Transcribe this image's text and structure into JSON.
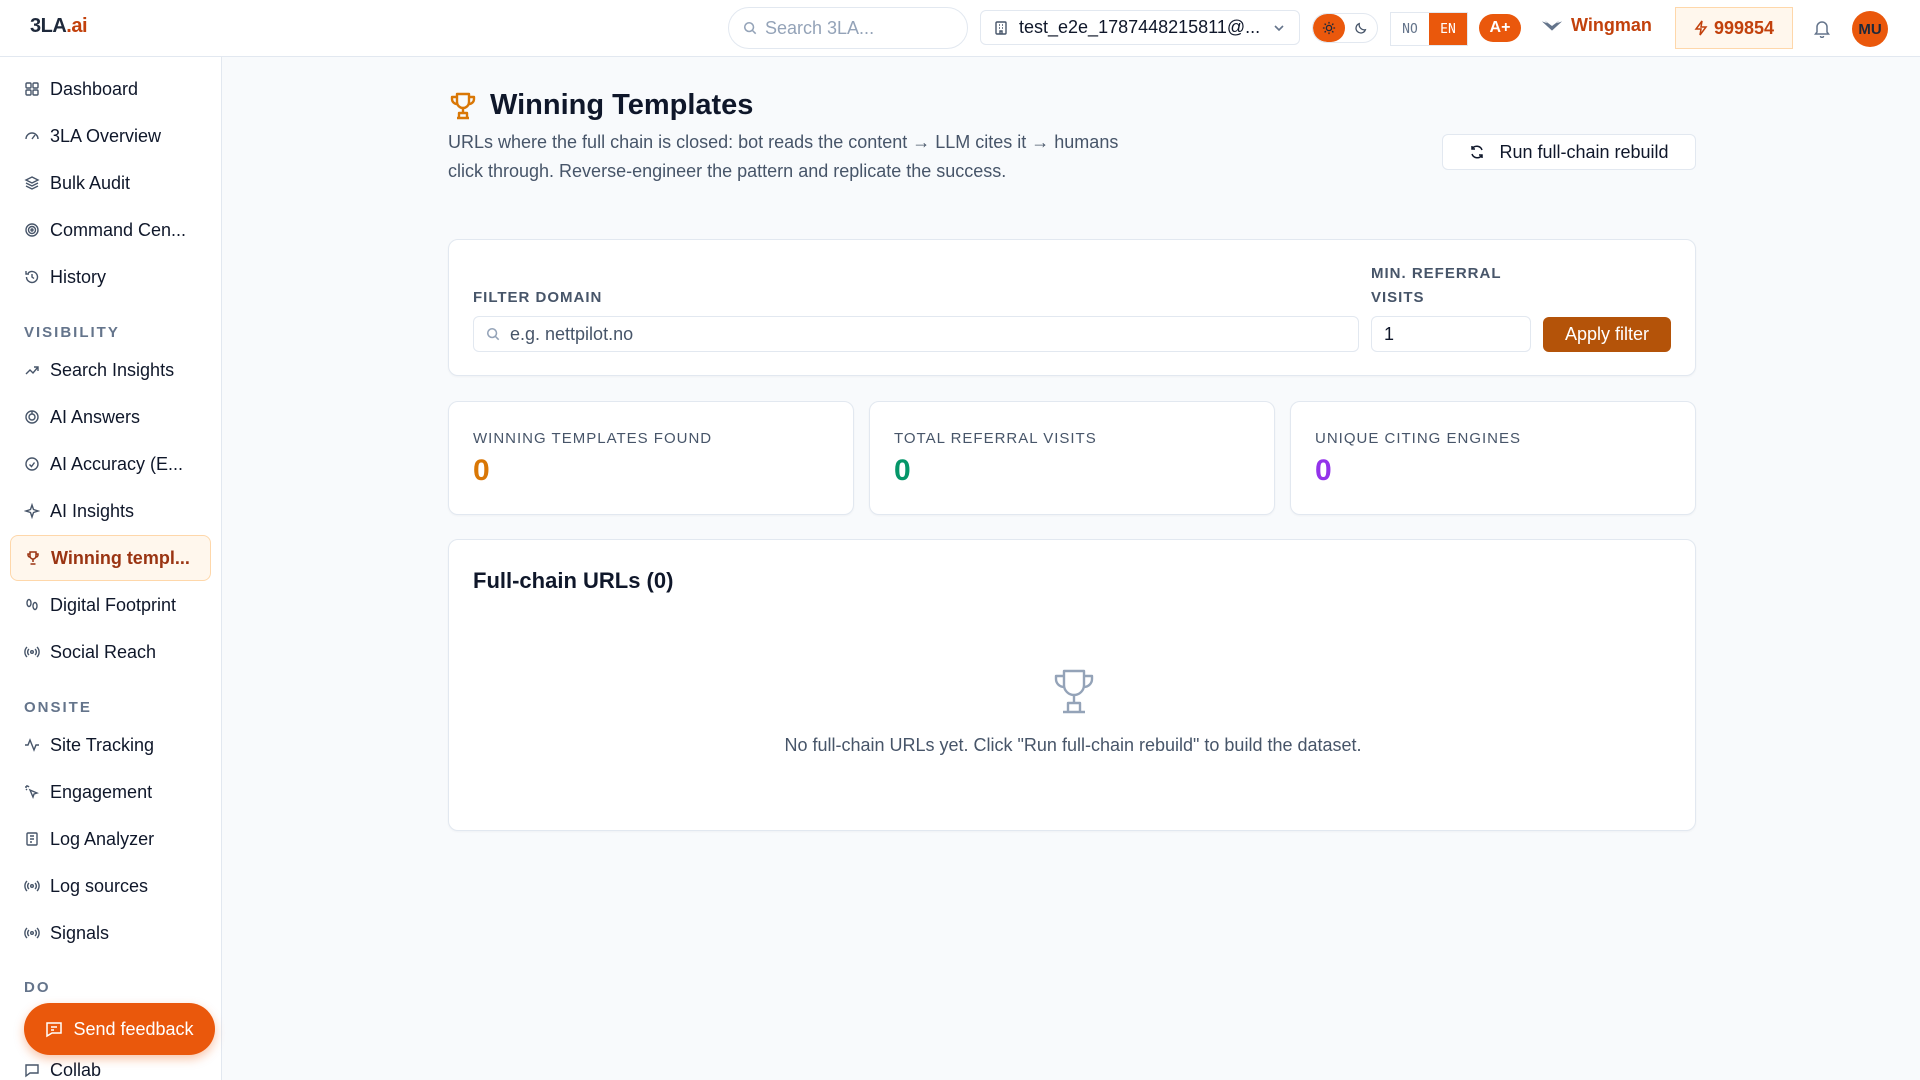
{
  "header": {
    "logo_main": "3LA",
    "logo_suffix": ".ai",
    "search_placeholder": "Search 3LA...",
    "project_name": "test_e2e_1787448215811@...",
    "lang_no": "NO",
    "lang_en": "EN",
    "grade": "A+",
    "wingman_label": "Wingman",
    "credits": "999854",
    "avatar_initials": "MU"
  },
  "sidebar": {
    "items": [
      {
        "label": "Dashboard",
        "icon": "grid-icon"
      },
      {
        "label": "3LA Overview",
        "icon": "gauge-icon"
      },
      {
        "label": "Bulk Audit",
        "icon": "layers-icon"
      },
      {
        "label": "Command Cen...",
        "icon": "target-icon"
      },
      {
        "label": "History",
        "icon": "history-icon"
      }
    ],
    "section_visibility": "VISIBILITY",
    "visibility_items": [
      {
        "label": "Search Insights",
        "icon": "trend-icon"
      },
      {
        "label": "AI Answers",
        "icon": "answers-icon"
      },
      {
        "label": "AI Accuracy (E...",
        "icon": "accuracy-icon"
      },
      {
        "label": "AI Insights",
        "icon": "sparkle-icon"
      },
      {
        "label": "Winning templ...",
        "icon": "trophy-icon",
        "active": true
      },
      {
        "label": "Digital Footprint",
        "icon": "footprint-icon"
      },
      {
        "label": "Social Reach",
        "icon": "broadcast-icon"
      }
    ],
    "section_onsite": "ONSITE",
    "onsite_items": [
      {
        "label": "Site Tracking",
        "icon": "activity-icon"
      },
      {
        "label": "Engagement",
        "icon": "pointer-icon"
      },
      {
        "label": "Log Analyzer",
        "icon": "log-icon"
      },
      {
        "label": "Log sources",
        "icon": "broadcast-icon"
      },
      {
        "label": "Signals",
        "icon": "broadcast-icon"
      }
    ],
    "section_do": "DO",
    "do_items": [
      {
        "label": "Collab",
        "icon": "chat-icon"
      }
    ],
    "feedback_label": "Send feedback"
  },
  "main": {
    "title": "Winning Templates",
    "description": "URLs where the full chain is closed: bot reads the content → LLM cites it → humans click through. Reverse-engineer the pattern and replicate the success.",
    "rebuild_label": "Run full-chain rebuild",
    "filter": {
      "domain_label": "FILTER DOMAIN",
      "domain_placeholder": "e.g. nettpilot.no",
      "visits_label": "MIN. REFERRAL VISITS",
      "visits_value": "1",
      "apply_label": "Apply filter"
    },
    "stats": [
      {
        "label": "WINNING TEMPLATES FOUND",
        "value": "0",
        "color": "#d97706"
      },
      {
        "label": "TOTAL REFERRAL VISITS",
        "value": "0",
        "color": "#059669"
      },
      {
        "label": "UNIQUE CITING ENGINES",
        "value": "0",
        "color": "#9333ea"
      }
    ],
    "list_title": "Full-chain URLs (0)",
    "empty_text": "No full-chain URLs yet. Click \"Run full-chain rebuild\" to build the dataset."
  },
  "colors": {
    "accent": "#ea580c",
    "accent_dark": "#c2410c",
    "apply": "#b45309"
  }
}
